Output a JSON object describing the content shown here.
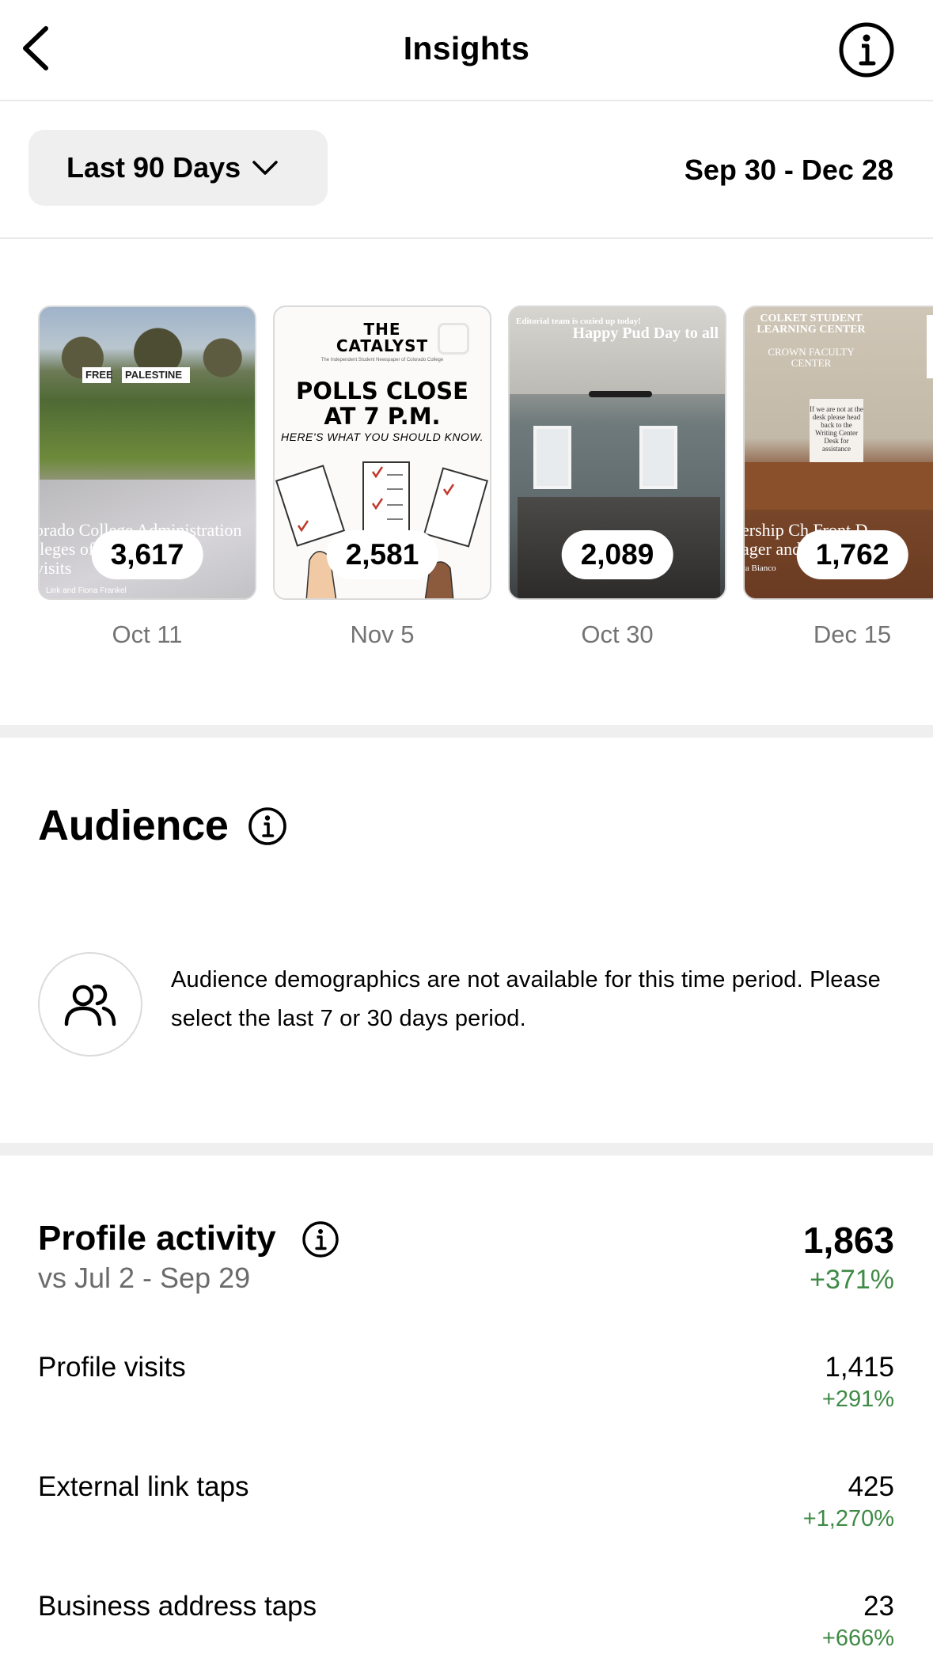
{
  "header": {
    "title": "Insights",
    "back_icon": "chevron-left-icon",
    "info_icon": "info-circle-icon"
  },
  "filter": {
    "period_label": "Last 90 Days",
    "date_range": "Sep 30 - Dec 28"
  },
  "stories": [
    {
      "count": "3,617",
      "date": "Oct 11",
      "signs": [
        "FREE",
        "PALESTINE"
      ],
      "overlay_lines": [
        "orado College Administration",
        "ileges of Student",
        "visits"
      ],
      "credit": "Link and Fiona Frankel"
    },
    {
      "count": "2,581",
      "date": "Nov 5",
      "brand": "THE CATALYST",
      "tagline": "The Independent Student Newspaper of Colorado College",
      "headline": "POLLS CLOSE AT 7 P.M.",
      "subhead": "HERE'S WHAT YOU SHOULD KNOW."
    },
    {
      "count": "2,089",
      "date": "Oct 30",
      "caption_small": "Editorial team is cozied up today!",
      "caption_large": "Happy Pud Day to all"
    },
    {
      "count": "1,762",
      "date": "Dec 15",
      "sign_lines": [
        "COLKET STUDENT",
        "LEARNING CENTER"
      ],
      "sign_sub": [
        "CROWN FACULTY",
        "CENTER"
      ],
      "card_text": "If we are not at the desk please head back to the Writing Center Desk for assistance",
      "overlay_lines": [
        "ership Ch Front D",
        "ager and s",
        "ca Bianco"
      ]
    }
  ],
  "audience": {
    "title": "Audience",
    "message": "Audience demographics are not available for this time period. Please select the last 7 or 30 days period."
  },
  "profile_activity": {
    "title": "Profile activity",
    "comparison": "vs Jul 2 - Sep 29",
    "total": "1,863",
    "total_change": "+371%",
    "metrics": [
      {
        "label": "Profile visits",
        "value": "1,415",
        "change": "+291%"
      },
      {
        "label": "External link taps",
        "value": "425",
        "change": "+1,270%"
      },
      {
        "label": "Business address taps",
        "value": "23",
        "change": "+666%"
      }
    ]
  },
  "colors": {
    "positive_change": "#3f8a45",
    "secondary_text": "#737373",
    "pill_bg": "#efefef",
    "divider": "#e9e9e9"
  }
}
